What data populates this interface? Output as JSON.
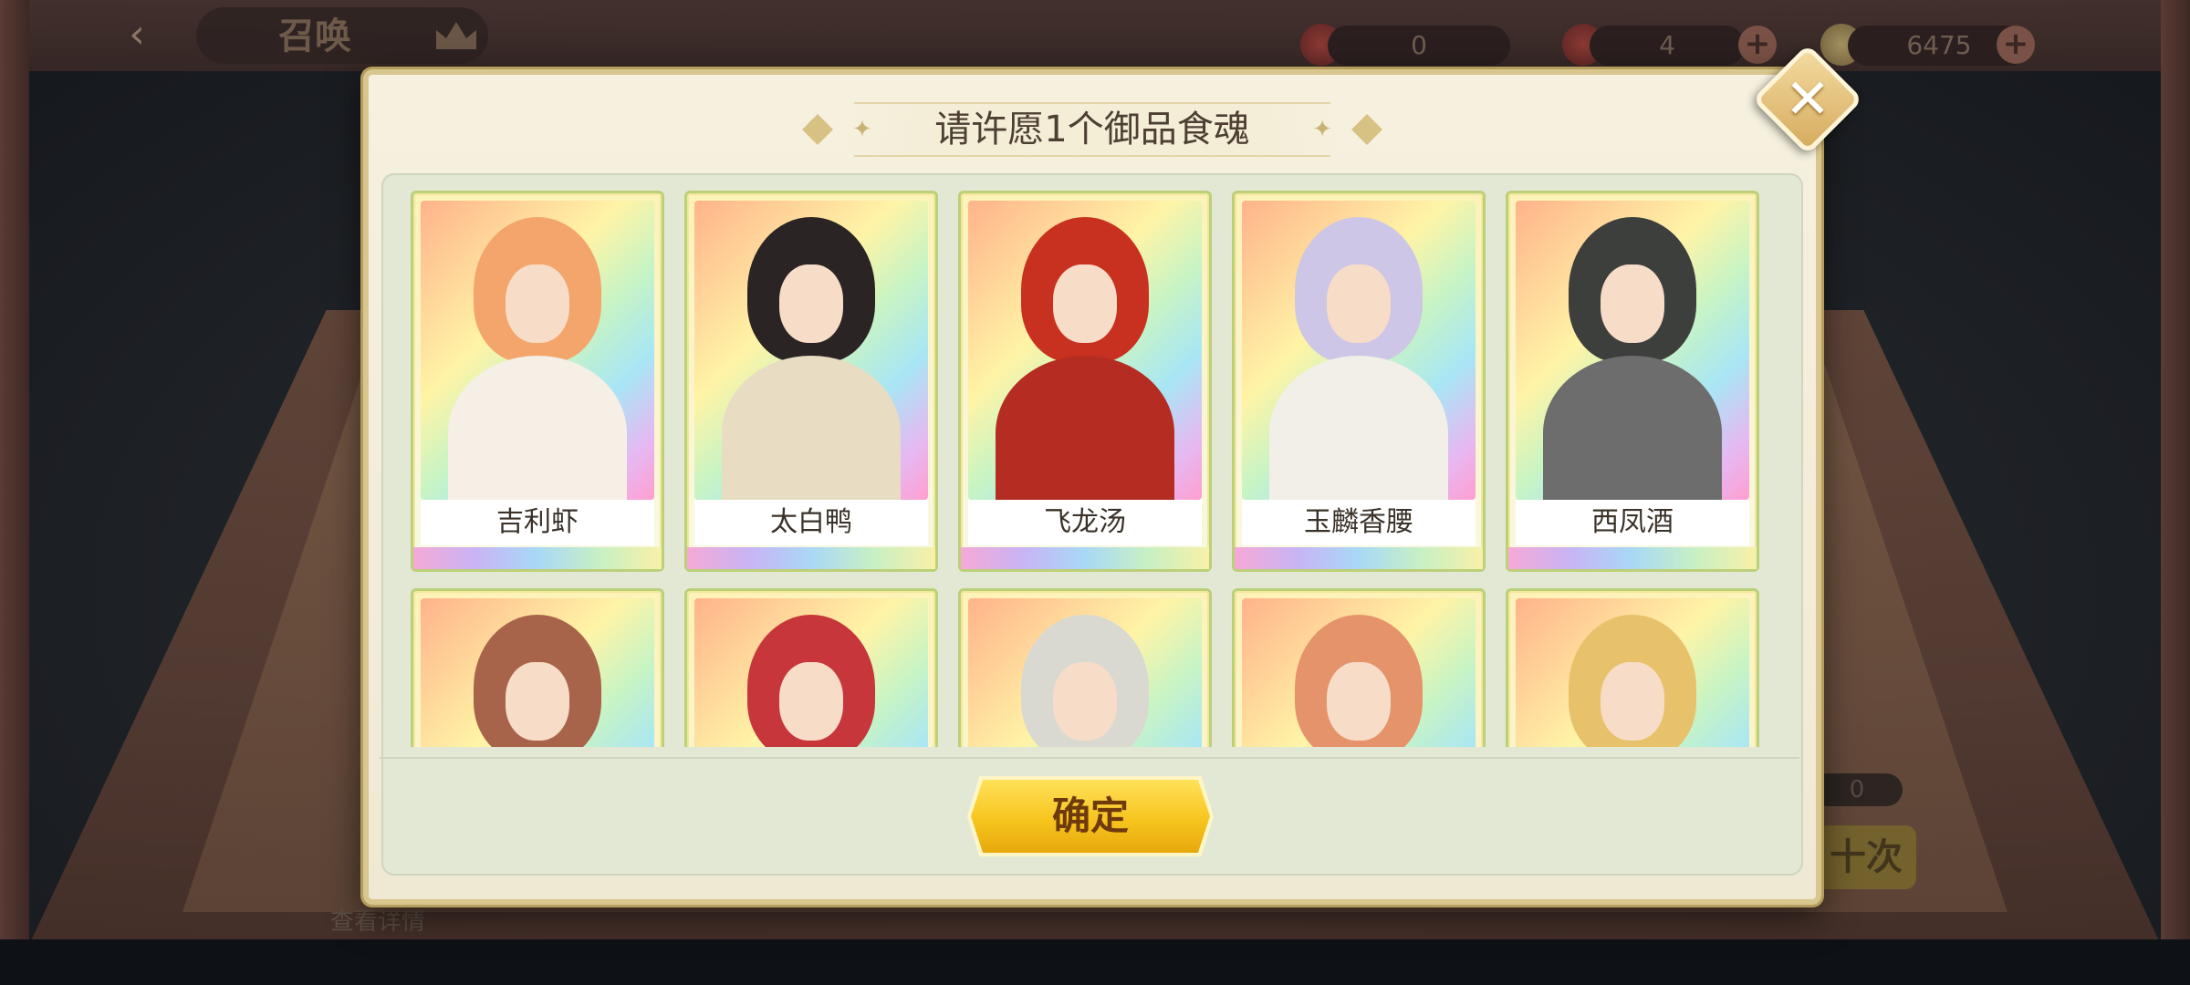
{
  "background": {
    "screen_title": "召唤",
    "resources": [
      {
        "icon": "red-ticket-icon",
        "value": "0"
      },
      {
        "icon": "red-ticket-icon",
        "value": "4"
      },
      {
        "icon": "coin-icon",
        "value": "6475"
      }
    ],
    "detail_link": "查看详情",
    "ten_pull_label": "十次",
    "counter_value": "0"
  },
  "dialog": {
    "title": "请许愿1个御品食魂",
    "confirm_label": "确定",
    "close_icon": "close-icon"
  },
  "cards": [
    {
      "name": "吉利虾",
      "hair": "#f3a56b",
      "outfit": "#f5efe6"
    },
    {
      "name": "太白鸭",
      "hair": "#2a2424",
      "outfit": "#e8dcc2"
    },
    {
      "name": "飞龙汤",
      "hair": "#c8311f",
      "outfit": "#b52d22"
    },
    {
      "name": "玉麟香腰",
      "hair": "#cdc6e6",
      "outfit": "#f2efe9"
    },
    {
      "name": "西凤酒",
      "hair": "#3c3f3c",
      "outfit": "#6d6d6d"
    },
    {
      "name": "",
      "hair": "#a7644a",
      "outfit": "#c98a6a"
    },
    {
      "name": "",
      "hair": "#c6363a",
      "outfit": "#b03a3a"
    },
    {
      "name": "",
      "hair": "#d9d9d2",
      "outfit": "#efefe8"
    },
    {
      "name": "",
      "hair": "#e4936a",
      "outfit": "#9fd1c4"
    },
    {
      "name": "",
      "hair": "#e7c26b",
      "outfit": "#e88b3a"
    }
  ]
}
